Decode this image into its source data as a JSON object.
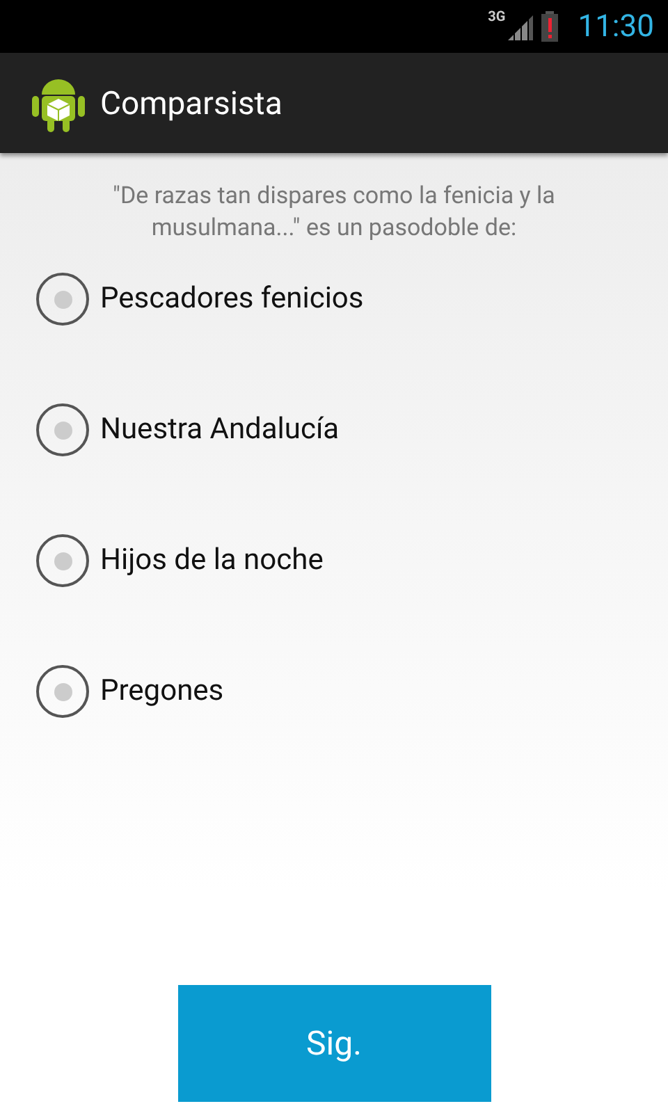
{
  "status_bar": {
    "network": "3G",
    "time": "11:30"
  },
  "action_bar": {
    "title": "Comparsista"
  },
  "question": "\"De razas tan dispares como la fenicia y la musulmana...\" es un pasodoble de:",
  "options": [
    {
      "label": "Pescadores fenicios",
      "selected": false
    },
    {
      "label": "Nuestra Andalucía",
      "selected": false
    },
    {
      "label": "Hijos de la noche",
      "selected": false
    },
    {
      "label": "Pregones",
      "selected": false
    }
  ],
  "button": {
    "label": "Sig."
  }
}
